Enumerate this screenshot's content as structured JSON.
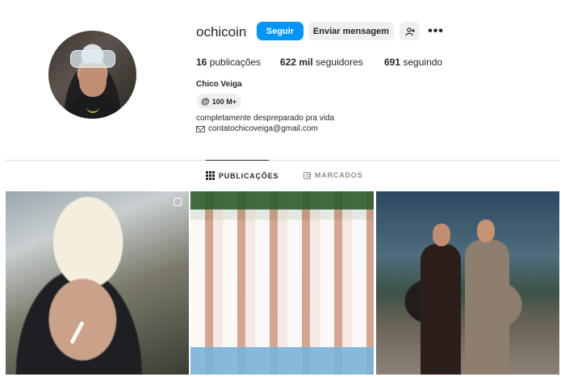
{
  "profile": {
    "username": "ochicoin",
    "full_name": "Chico Veiga",
    "threads_badge": "100 M+",
    "bio": "completamente despreparado pra vida",
    "email": "contatochicoveiga@gmail.com"
  },
  "actions": {
    "follow_label": "Seguir",
    "message_label": "Enviar mensagem",
    "suggest_icon": "person-plus-icon",
    "more_label": "•••"
  },
  "stats": {
    "posts_count": "16",
    "posts_label": "publicações",
    "followers_count": "622 mil",
    "followers_label": "seguidores",
    "following_count": "691",
    "following_label": "seguindo"
  },
  "tabs": [
    {
      "label": "PUBLICAÇÕES",
      "icon": "grid-icon",
      "active": true
    },
    {
      "label": "MARCADOS",
      "icon": "tag-icon",
      "active": false
    }
  ],
  "colors": {
    "accent": "#0095f6",
    "text": "#262626",
    "muted": "#8e8e8e",
    "button_bg": "#efefef"
  }
}
